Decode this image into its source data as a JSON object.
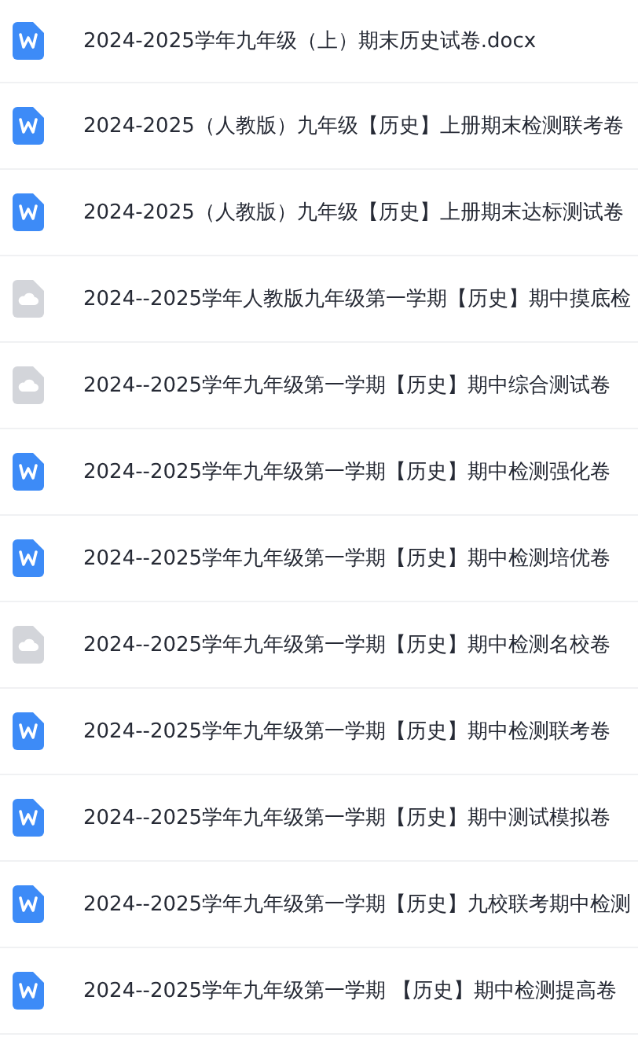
{
  "files": [
    {
      "kind": "word",
      "name": "2024-2025学年九年级（上）期末历史试卷.docx"
    },
    {
      "kind": "word",
      "name": "2024-2025（人教版）九年级【历史】上册期末检测联考卷"
    },
    {
      "kind": "word",
      "name": "2024-2025（人教版）九年级【历史】上册期末达标测试卷"
    },
    {
      "kind": "cloud",
      "name": "2024--2025学年人教版九年级第一学期【历史】期中摸底检"
    },
    {
      "kind": "cloud",
      "name": "2024--2025学年九年级第一学期【历史】期中综合测试卷"
    },
    {
      "kind": "word",
      "name": "2024--2025学年九年级第一学期【历史】期中检测强化卷"
    },
    {
      "kind": "word",
      "name": "2024--2025学年九年级第一学期【历史】期中检测培优卷"
    },
    {
      "kind": "cloud",
      "name": "2024--2025学年九年级第一学期【历史】期中检测名校卷"
    },
    {
      "kind": "word",
      "name": "2024--2025学年九年级第一学期【历史】期中检测联考卷"
    },
    {
      "kind": "word",
      "name": "2024--2025学年九年级第一学期【历史】期中测试模拟卷"
    },
    {
      "kind": "word",
      "name": "2024--2025学年九年级第一学期【历史】九校联考期中检测"
    },
    {
      "kind": "word",
      "name": "2024--2025学年九年级第一学期 【历史】期中检测提高卷"
    }
  ]
}
